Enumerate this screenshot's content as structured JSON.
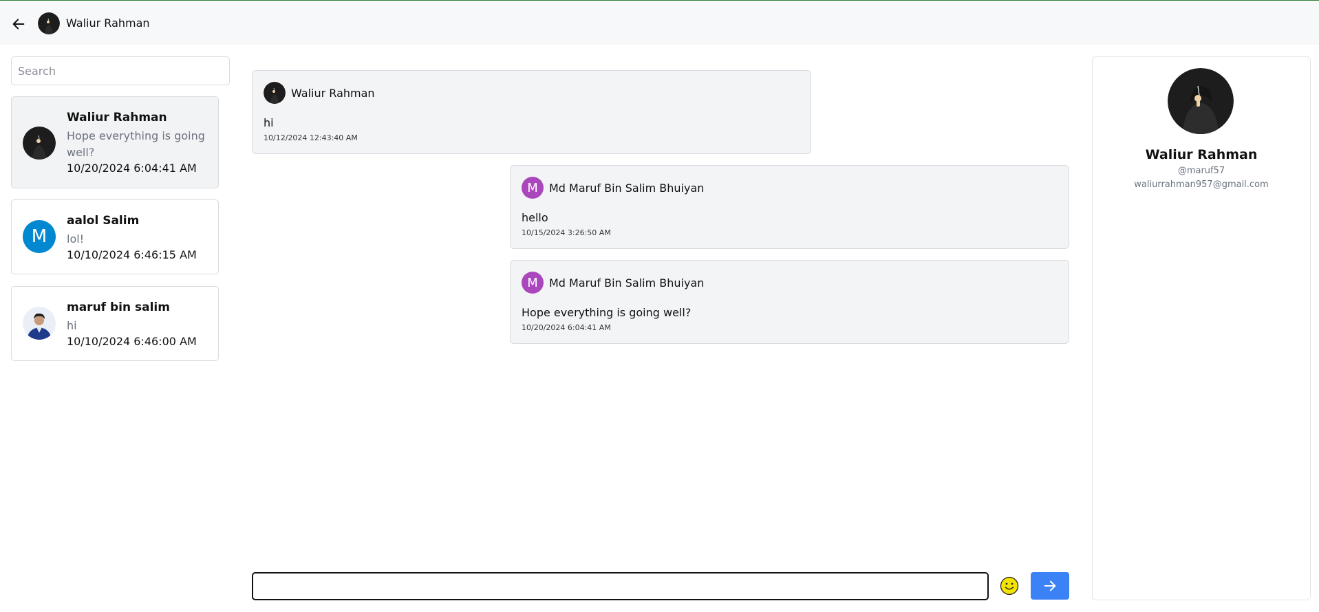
{
  "header": {
    "contact_name": "Waliur Rahman"
  },
  "search": {
    "placeholder": "Search"
  },
  "conversations": [
    {
      "name": "Waliur Rahman",
      "preview": "Hope everything is going well?",
      "time": "10/20/2024 6:04:41 AM",
      "active": true
    },
    {
      "name": "aalol Salim",
      "avatar_letter": "M",
      "preview": "lol!",
      "time": "10/10/2024 6:46:15 AM"
    },
    {
      "name": "maruf bin salim",
      "preview": "hi",
      "time": "10/10/2024 6:46:00 AM"
    }
  ],
  "messages": [
    {
      "sender": "Waliur Rahman",
      "text": "hi",
      "time": "10/12/2024 12:43:40 AM",
      "side": "left"
    },
    {
      "sender": "Md Maruf Bin Salim Bhuiyan",
      "avatar_letter": "M",
      "text": "hello",
      "time": "10/15/2024 3:26:50 AM",
      "side": "right"
    },
    {
      "sender": "Md Maruf Bin Salim Bhuiyan",
      "avatar_letter": "M",
      "text": "Hope everything is going well?",
      "time": "10/20/2024 6:04:41 AM",
      "side": "right"
    }
  ],
  "composer": {
    "value": ""
  },
  "profile": {
    "name": "Waliur Rahman",
    "username": "@maruf57",
    "email": "waliurrahman957@gmail.com"
  },
  "colors": {
    "accent": "#3b82f6",
    "letter_avatar_purple": "#ab47bc",
    "letter_avatar_blue": "#0288d1",
    "emoji_yellow": "#f5e400"
  },
  "icons": {
    "back": "arrow-left-icon",
    "emoji": "smiley-icon",
    "send": "arrow-right-icon"
  }
}
